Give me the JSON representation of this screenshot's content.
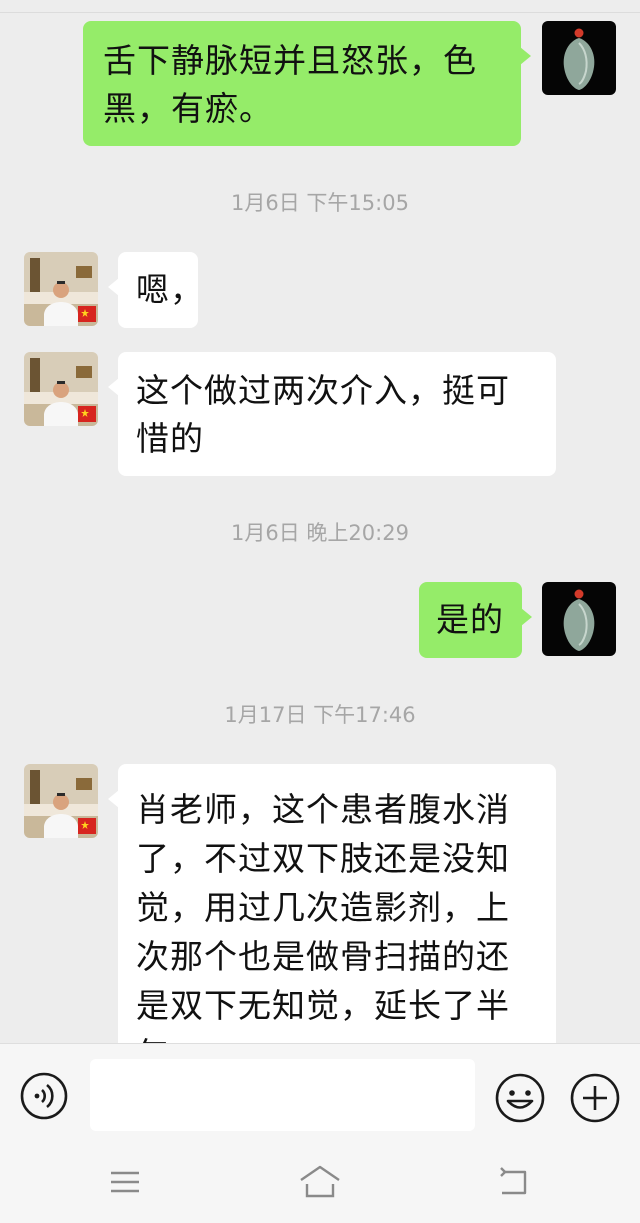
{
  "messages": [
    {
      "from": "self",
      "lines": [
        "舌下静脉短并且怒张，色",
        "黑，有瘀。"
      ]
    },
    {
      "timestamp": "1月6日 下午15:05"
    },
    {
      "from": "doctor",
      "lines": [
        "嗯，"
      ]
    },
    {
      "from": "doctor",
      "lines": [
        "这个做过两次介入，挺可",
        "惜的"
      ]
    },
    {
      "timestamp": "1月6日 晚上20:29"
    },
    {
      "from": "self",
      "lines": [
        "是的"
      ]
    },
    {
      "timestamp": "1月17日 下午17:46"
    },
    {
      "from": "doctor",
      "lines": [
        "肖老师，这个患者腹水消",
        "了，不过双下肢还是没知",
        "觉，用过几次造影剂，上",
        "次那个也是做骨扫描的还",
        "是双下无知觉，延长了半",
        "年。"
      ]
    }
  ],
  "input_bar": {
    "voice_icon": "voice-icon",
    "message_input_value": "",
    "emoji_icon": "emoji-icon",
    "plus_icon": "plus-icon"
  },
  "nav_bar": {
    "menu_icon": "menu-icon",
    "home_icon": "home-icon",
    "back_icon": "back-icon"
  },
  "colors": {
    "outgoing_bubble": "#95ec69",
    "incoming_bubble": "#ffffff",
    "background": "#ededed",
    "timestamp_text": "#a6a6a6"
  }
}
